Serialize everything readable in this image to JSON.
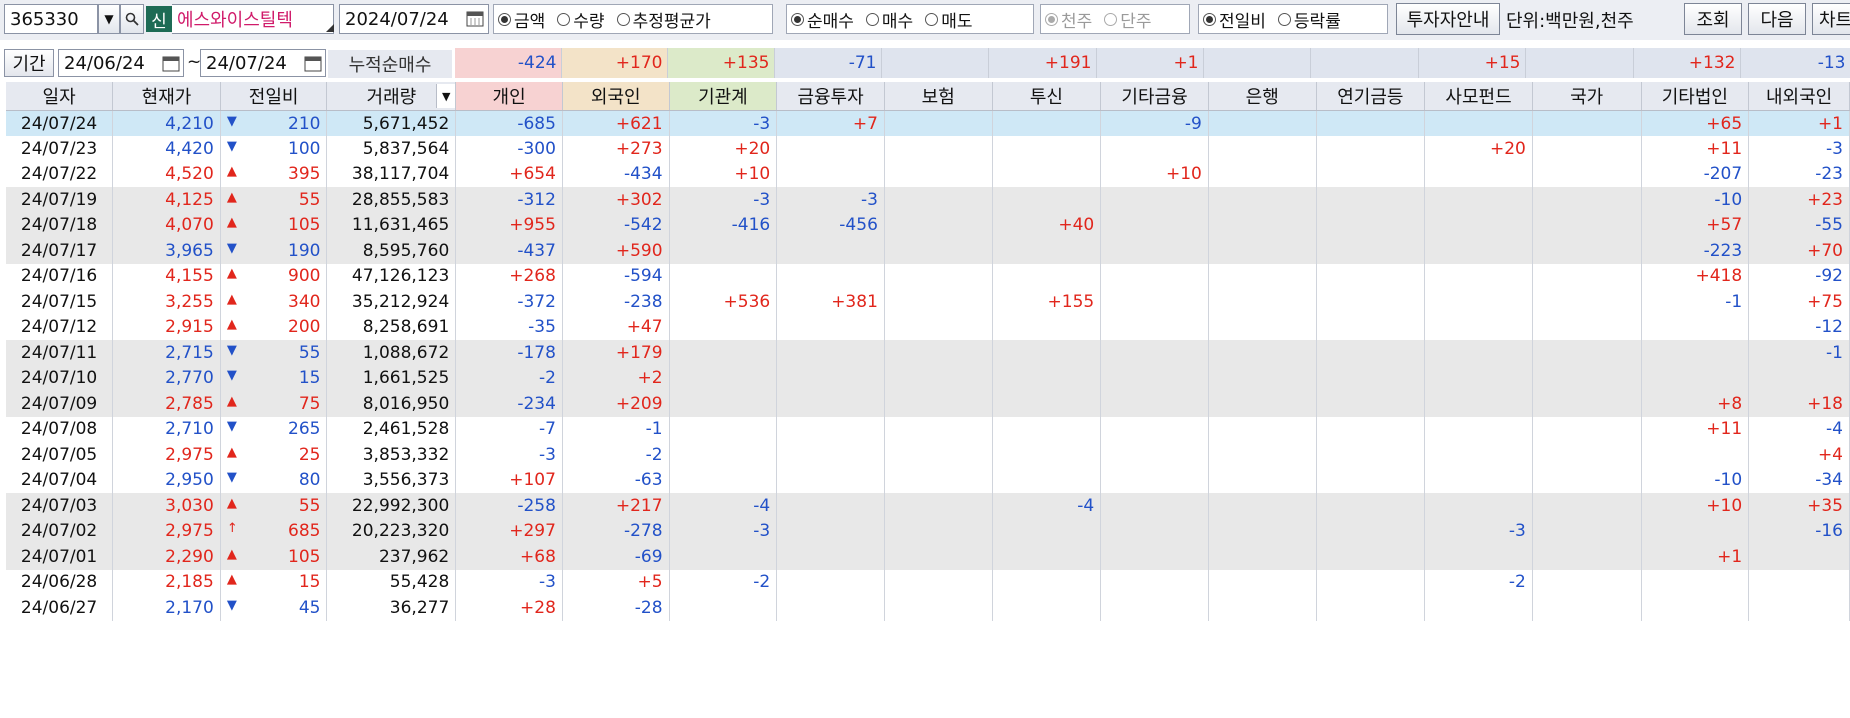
{
  "toolbar": {
    "code": "365330",
    "badge": "신",
    "stock_name": "에스와이스틸텍",
    "date": "2024/07/24",
    "radio_amount": [
      "금액",
      "수량",
      "추정평균가"
    ],
    "radio_net": [
      "순매수",
      "매수",
      "매도"
    ],
    "radio_unit": [
      "천주",
      "단주"
    ],
    "radio_change": [
      "전일비",
      "등락률"
    ],
    "guide_button": "투자자안내",
    "unit_label": "단위:백만원,천주",
    "query_button": "조회",
    "next_button": "다음",
    "chart_button": "차트"
  },
  "period": {
    "label": "기간",
    "from": "24/06/24",
    "tilde": "~",
    "to": "24/07/24",
    "cum_label": "누적순매수",
    "totals": [
      "-424",
      "+170",
      "+135",
      "-71",
      "",
      "+191",
      "+1",
      "",
      "",
      "+15",
      "",
      "+132",
      "-13"
    ]
  },
  "colors": {
    "up": "#e1261c",
    "down": "#2251c8",
    "individual_bg": "#f7d2d2",
    "foreign_bg": "#f3e3c8",
    "institution_bg": "#dceac9",
    "other_bg": "#dfe4ee"
  },
  "columns": [
    "일자",
    "현재가",
    "전일비",
    "거래량",
    "개인",
    "외국인",
    "기관계",
    "금융투자",
    "보험",
    "투신",
    "기타금융",
    "은행",
    "연기금등",
    "사모펀드",
    "국가",
    "기타법인",
    "내외국인"
  ],
  "rows": [
    {
      "date": "24/07/24",
      "price": "4,210",
      "dir": "down",
      "arrow": "▼",
      "chg": "210",
      "vol": "5,671,452",
      "v": [
        "-685",
        "+621",
        "-3",
        "+7",
        "",
        "",
        "-9",
        "",
        "",
        "",
        "",
        "+65",
        "+1"
      ]
    },
    {
      "date": "24/07/23",
      "price": "4,420",
      "dir": "down",
      "arrow": "▼",
      "chg": "100",
      "vol": "5,837,564",
      "v": [
        "-300",
        "+273",
        "+20",
        "",
        "",
        "",
        "",
        "",
        "",
        "+20",
        "",
        "+11",
        "-3"
      ]
    },
    {
      "date": "24/07/22",
      "price": "4,520",
      "dir": "up",
      "arrow": "▲",
      "chg": "395",
      "vol": "38,117,704",
      "v": [
        "+654",
        "-434",
        "+10",
        "",
        "",
        "",
        "+10",
        "",
        "",
        "",
        "",
        "-207",
        "-23"
      ]
    },
    {
      "date": "24/07/19",
      "price": "4,125",
      "dir": "up",
      "arrow": "▲",
      "chg": "55",
      "vol": "28,855,583",
      "v": [
        "-312",
        "+302",
        "-3",
        "-3",
        "",
        "",
        "",
        "",
        "",
        "",
        "",
        "-10",
        "+23"
      ]
    },
    {
      "date": "24/07/18",
      "price": "4,070",
      "dir": "up",
      "arrow": "▲",
      "chg": "105",
      "vol": "11,631,465",
      "v": [
        "+955",
        "-542",
        "-416",
        "-456",
        "",
        "+40",
        "",
        "",
        "",
        "",
        "",
        "+57",
        "-55"
      ]
    },
    {
      "date": "24/07/17",
      "price": "3,965",
      "dir": "down",
      "arrow": "▼",
      "chg": "190",
      "vol": "8,595,760",
      "v": [
        "-437",
        "+590",
        "",
        "",
        "",
        "",
        "",
        "",
        "",
        "",
        "",
        "-223",
        "+70"
      ]
    },
    {
      "date": "24/07/16",
      "price": "4,155",
      "dir": "up",
      "arrow": "▲",
      "chg": "900",
      "vol": "47,126,123",
      "v": [
        "+268",
        "-594",
        "",
        "",
        "",
        "",
        "",
        "",
        "",
        "",
        "",
        "+418",
        "-92"
      ]
    },
    {
      "date": "24/07/15",
      "price": "3,255",
      "dir": "up",
      "arrow": "▲",
      "chg": "340",
      "vol": "35,212,924",
      "v": [
        "-372",
        "-238",
        "+536",
        "+381",
        "",
        "+155",
        "",
        "",
        "",
        "",
        "",
        "-1",
        "+75"
      ]
    },
    {
      "date": "24/07/12",
      "price": "2,915",
      "dir": "up",
      "arrow": "▲",
      "chg": "200",
      "vol": "8,258,691",
      "v": [
        "-35",
        "+47",
        "",
        "",
        "",
        "",
        "",
        "",
        "",
        "",
        "",
        "",
        "-12"
      ]
    },
    {
      "date": "24/07/11",
      "price": "2,715",
      "dir": "down",
      "arrow": "▼",
      "chg": "55",
      "vol": "1,088,672",
      "v": [
        "-178",
        "+179",
        "",
        "",
        "",
        "",
        "",
        "",
        "",
        "",
        "",
        "",
        "-1"
      ]
    },
    {
      "date": "24/07/10",
      "price": "2,770",
      "dir": "down",
      "arrow": "▼",
      "chg": "15",
      "vol": "1,661,525",
      "v": [
        "-2",
        "+2",
        "",
        "",
        "",
        "",
        "",
        "",
        "",
        "",
        "",
        "",
        ""
      ]
    },
    {
      "date": "24/07/09",
      "price": "2,785",
      "dir": "up",
      "arrow": "▲",
      "chg": "75",
      "vol": "8,016,950",
      "v": [
        "-234",
        "+209",
        "",
        "",
        "",
        "",
        "",
        "",
        "",
        "",
        "",
        "+8",
        "+18"
      ]
    },
    {
      "date": "24/07/08",
      "price": "2,710",
      "dir": "down",
      "arrow": "▼",
      "chg": "265",
      "vol": "2,461,528",
      "v": [
        "-7",
        "-1",
        "",
        "",
        "",
        "",
        "",
        "",
        "",
        "",
        "",
        "+11",
        "-4"
      ]
    },
    {
      "date": "24/07/05",
      "price": "2,975",
      "dir": "up",
      "arrow": "▲",
      "chg": "25",
      "vol": "3,853,332",
      "v": [
        "-3",
        "-2",
        "",
        "",
        "",
        "",
        "",
        "",
        "",
        "",
        "",
        "",
        "+4"
      ]
    },
    {
      "date": "24/07/04",
      "price": "2,950",
      "dir": "down",
      "arrow": "▼",
      "chg": "80",
      "vol": "3,556,373",
      "v": [
        "+107",
        "-63",
        "",
        "",
        "",
        "",
        "",
        "",
        "",
        "",
        "",
        "-10",
        "-34"
      ]
    },
    {
      "date": "24/07/03",
      "price": "3,030",
      "dir": "up",
      "arrow": "▲",
      "chg": "55",
      "vol": "22,992,300",
      "v": [
        "-258",
        "+217",
        "-4",
        "",
        "",
        "-4",
        "",
        "",
        "",
        "",
        "",
        "+10",
        "+35"
      ]
    },
    {
      "date": "24/07/02",
      "price": "2,975",
      "dir": "up",
      "arrow": "↑",
      "chg": "685",
      "vol": "20,223,320",
      "v": [
        "+297",
        "-278",
        "-3",
        "",
        "",
        "",
        "",
        "",
        "",
        "-3",
        "",
        "",
        "-16"
      ]
    },
    {
      "date": "24/07/01",
      "price": "2,290",
      "dir": "up",
      "arrow": "▲",
      "chg": "105",
      "vol": "237,962",
      "v": [
        "+68",
        "-69",
        "",
        "",
        "",
        "",
        "",
        "",
        "",
        "",
        "",
        "+1",
        ""
      ]
    },
    {
      "date": "24/06/28",
      "price": "2,185",
      "dir": "up",
      "arrow": "▲",
      "chg": "15",
      "vol": "55,428",
      "v": [
        "-3",
        "+5",
        "-2",
        "",
        "",
        "",
        "",
        "",
        "",
        "-2",
        "",
        "",
        ""
      ]
    },
    {
      "date": "24/06/27",
      "price": "2,170",
      "dir": "down",
      "arrow": "▼",
      "chg": "45",
      "vol": "36,277",
      "v": [
        "+28",
        "-28",
        "",
        "",
        "",
        "",
        "",
        "",
        "",
        "",
        "",
        "",
        ""
      ]
    }
  ]
}
